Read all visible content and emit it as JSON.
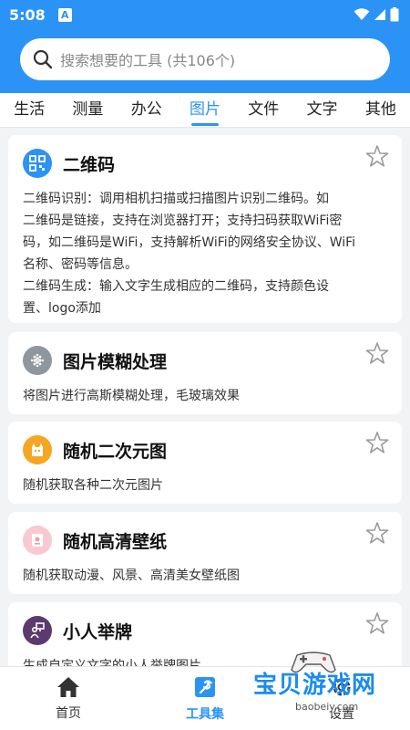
{
  "status": {
    "time": "5:08",
    "app_badge": "A"
  },
  "search": {
    "placeholder": "搜索想要的工具 (共106个)"
  },
  "tabs": [
    {
      "label": "生活",
      "active": false
    },
    {
      "label": "测量",
      "active": false
    },
    {
      "label": "办公",
      "active": false
    },
    {
      "label": "图片",
      "active": true
    },
    {
      "label": "文件",
      "active": false
    },
    {
      "label": "文字",
      "active": false
    },
    {
      "label": "其他",
      "active": false
    }
  ],
  "tools": [
    {
      "title": "二维码",
      "icon": "qrcode-icon",
      "color": "#2b93f5",
      "desc": "二维码识别：调用相机扫描或扫描图片识别二维码。如\n二维码是链接，支持在浏览器打开；支持扫码获取WiFi密\n码，如二维码是WiFi，支持解析WiFi的网络安全协议、WiFi\n名称、密码等信息。\n二维码生成：输入文字生成相应的二维码，支持颜色设\n置、logo添加"
    },
    {
      "title": "图片模糊处理",
      "icon": "blur-icon",
      "color": "#8e969e",
      "desc": "将图片进行高斯模糊处理，毛玻璃效果"
    },
    {
      "title": "随机二次元图",
      "icon": "anime-icon",
      "color": "#f5a623",
      "desc": "随机获取各种二次元图片"
    },
    {
      "title": "随机高清壁纸",
      "icon": "wallpaper-icon",
      "color": "#f8c9d2",
      "desc": "随机获取动漫、风景、高清美女壁纸图"
    },
    {
      "title": "小人举牌",
      "icon": "sign-person-icon",
      "color": "#5b3a6e",
      "desc": "生成自定义文字的小人举牌图片"
    }
  ],
  "nav": [
    {
      "label": "首页",
      "icon": "home-icon",
      "active": false
    },
    {
      "label": "工具集",
      "icon": "toolkit-icon",
      "active": true
    },
    {
      "label": "设置",
      "icon": "settings-icon",
      "active": false
    }
  ],
  "watermark": {
    "text": "宝贝游戏网",
    "sub": "baobeiy.com"
  },
  "colors": {
    "primary": "#2b93f5",
    "background": "#f2f3f5"
  }
}
